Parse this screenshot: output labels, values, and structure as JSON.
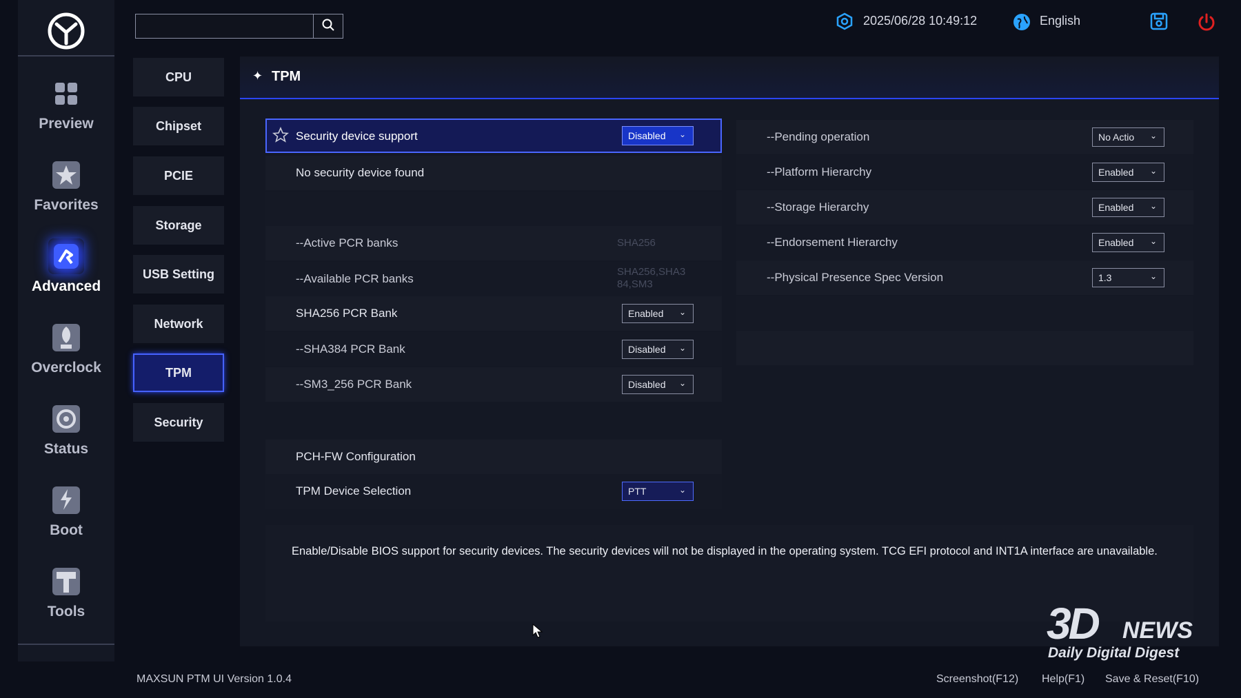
{
  "rail": {
    "items": [
      {
        "label": "Preview",
        "icon": "preview-icon"
      },
      {
        "label": "Favorites",
        "icon": "favorites-icon"
      },
      {
        "label": "Advanced",
        "icon": "advanced-icon",
        "active": true
      },
      {
        "label": "Overclock",
        "icon": "overclock-icon"
      },
      {
        "label": "Status",
        "icon": "status-icon"
      },
      {
        "label": "Boot",
        "icon": "boot-icon"
      },
      {
        "label": "Tools",
        "icon": "tools-icon"
      }
    ]
  },
  "topbar": {
    "search_placeholder": "",
    "datetime": "2025/06/28 10:49:12",
    "language": "English"
  },
  "subnav": {
    "items": [
      "CPU",
      "Chipset",
      "PCIE",
      "Storage",
      "USB Setting",
      "Network",
      "TPM",
      "Security"
    ],
    "active": "TPM"
  },
  "panel": {
    "title": "TPM",
    "left": {
      "security_device_support": {
        "label": "Security device support",
        "value": "Disabled"
      },
      "no_device": "No security device found",
      "active_pcr": {
        "label": "--Active PCR banks",
        "value": "SHA256"
      },
      "available_pcr": {
        "label": "--Available PCR banks",
        "value_line1": "SHA256,SHA3",
        "value_line2": "84,SM3"
      },
      "sha256_bank": {
        "label": "SHA256 PCR Bank",
        "value": "Enabled"
      },
      "sha384_bank": {
        "label": "--SHA384 PCR Bank",
        "value": "Disabled"
      },
      "sm3_bank": {
        "label": "--SM3_256 PCR Bank",
        "value": "Disabled"
      },
      "pch_fw": "PCH-FW Configuration",
      "tpm_device_selection": {
        "label": "TPM Device Selection",
        "value": "PTT"
      }
    },
    "right": {
      "pending_operation": {
        "label": "--Pending operation",
        "value": "No Actio"
      },
      "platform_hierarchy": {
        "label": "--Platform Hierarchy",
        "value": "Enabled"
      },
      "storage_hierarchy": {
        "label": "--Storage Hierarchy",
        "value": "Enabled"
      },
      "endorsement_hierarchy": {
        "label": "--Endorsement Hierarchy",
        "value": "Enabled"
      },
      "physical_presence": {
        "label": "--Physical Presence Spec Version",
        "value": "1.3"
      }
    },
    "description": "Enable/Disable BIOS support for security devices. The security devices will not be displayed in the operating system. TCG EFI protocol and INT1A interface are unavailable."
  },
  "footer": {
    "version": "MAXSUN PTM UI Version 1.0.4",
    "screenshot": "Screenshot(F12)",
    "help": "Help(F1)",
    "save_reset": "Save & Reset(F10)"
  },
  "watermark": {
    "brand_3d": "3D",
    "brand_news": "NEWS",
    "tagline": "Daily Digital Digest"
  },
  "colors": {
    "accent": "#2b45ff",
    "highlight": "#1835c8",
    "power": "#e02020",
    "info": "#2aa3ff"
  }
}
